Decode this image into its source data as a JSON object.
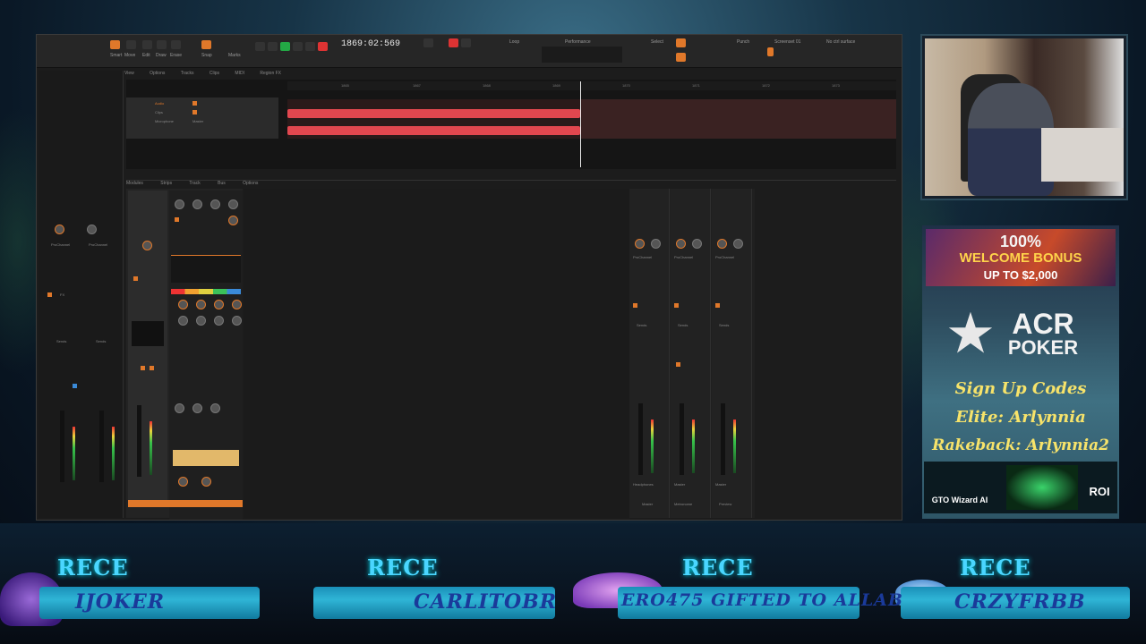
{
  "daw": {
    "time_display": "1869:02:569",
    "menu": [
      "View",
      "Options",
      "Tracks",
      "Clips",
      "MIDI",
      "Region FX"
    ],
    "console_menu": [
      "Modules",
      "Strips",
      "Track",
      "Bus",
      "Options"
    ],
    "toolbar_labels": {
      "loop": "Loop",
      "performance": "Performance",
      "select": "Select",
      "punch": "Punch",
      "screenset": "Screenset 01",
      "control_surface": "No ctrl surface",
      "smart": "Smart",
      "move": "Move",
      "edit": "Edit",
      "draw": "Draw",
      "erase": "Erase",
      "snap": "Snap",
      "marks": "Marks"
    },
    "track": {
      "name": "Audio",
      "clips_label": "Clips",
      "input": "Microphone",
      "output": "Master"
    },
    "ruler_ticks": [
      "1865",
      "1867",
      "1868",
      "1869",
      "1870",
      "1871",
      "1872",
      "1873"
    ],
    "buses": [
      {
        "label": "Headphones",
        "out": "Master",
        "name": "Master"
      },
      {
        "label": "Metronome",
        "out": "Master",
        "name": "Metronome"
      },
      {
        "label": "Master",
        "out": "Master",
        "name": "Preview"
      }
    ],
    "prochannel_label": "ProChannel",
    "sends_label": "Sends",
    "fx_label": "FX"
  },
  "ad": {
    "line1": "100%",
    "line2": "WELCOME BONUS",
    "line3": "UP TO $2,000",
    "brand_top": "ACR",
    "brand_bottom": "POKER",
    "signup": "Sign Up Codes",
    "code1": "Elite: Arlynnia",
    "code2": "Rakeback: Arlynnia2",
    "gto": "GTO Wizard AI",
    "roi": "ROI"
  },
  "banner": {
    "items": [
      {
        "title": "RECE",
        "name": "IJOKER"
      },
      {
        "title": "RECE",
        "name": "CARLITOBR"
      },
      {
        "title": "RECE",
        "name": "ERO475 GIFTED TO ALLAB"
      },
      {
        "title": "RECE",
        "name": "CRZYFRBB"
      }
    ]
  },
  "colors": {
    "clip": "#e2474f",
    "accent": "#e0782a",
    "banner_text": "#4ad6ff"
  }
}
